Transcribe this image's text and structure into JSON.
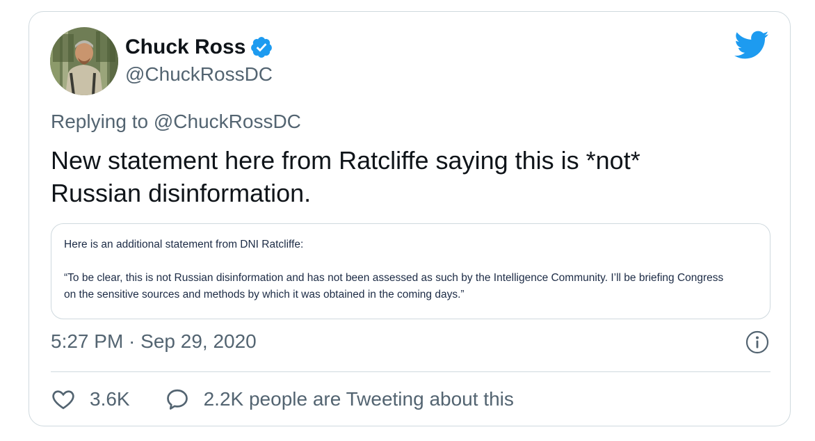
{
  "author": {
    "display_name": "Chuck Ross",
    "handle": "@ChuckRossDC",
    "verified": true
  },
  "reply_context": "Replying to @ChuckRossDC",
  "tweet": {
    "text_line1": "New statement here from Ratcliffe saying this is *not*",
    "text_line2": "Russian disinformation."
  },
  "quoted_image": {
    "intro": "Here is an additional statement from DNI Ratcliffe:",
    "body_line1": "“To be clear, this is not Russian disinformation and has not been assessed as such by the Intelligence Community.  I’ll be briefing Congress",
    "body_line2": "on the sensitive sources and methods by which it was obtained in the coming days.”"
  },
  "timestamp": "5:27 PM · Sep 29, 2020",
  "engagement": {
    "likes": "3.6K",
    "conversation": "2.2K people are Tweeting about this"
  },
  "icons": {
    "brand": "twitter-bird-icon",
    "verified": "verified-badge-icon",
    "info": "info-icon",
    "like": "heart-icon",
    "reply": "speech-bubble-icon"
  },
  "colors": {
    "brand_blue": "#1d9bf0",
    "text_primary": "#0f1419",
    "text_secondary": "#536471",
    "border": "#cfd9de",
    "quote_text": "#1c2b45"
  }
}
